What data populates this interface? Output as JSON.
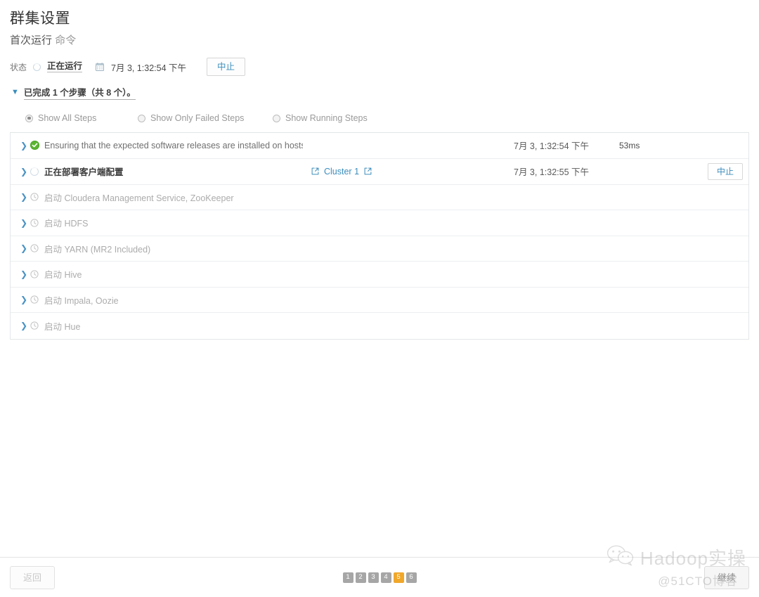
{
  "header": {
    "title": "群集设置",
    "subtitle_strong": "首次运行",
    "subtitle_light": "命令"
  },
  "status": {
    "label": "状态",
    "state_text": "正在运行",
    "spinner_icon": "spinner-icon",
    "calendar_icon": "calendar-icon",
    "time": "7月 3, 1:32:54 下午",
    "abort_label": "中止"
  },
  "progress": {
    "chevron_icon": "chevron-down-icon",
    "summary": "已完成 1 个步骤（共 8 个）。"
  },
  "filters": [
    {
      "label": "Show All Steps",
      "selected": true
    },
    {
      "label": "Show Only Failed Steps",
      "selected": false
    },
    {
      "label": "Show Running Steps",
      "selected": false
    }
  ],
  "steps": [
    {
      "name": "Ensuring that the expected software releases are installed on hosts.",
      "state": "done",
      "status_icon": "check-circle-icon",
      "context": "",
      "context_link_icon": "",
      "time": "7月 3, 1:32:54 下午",
      "duration": "53ms",
      "action": ""
    },
    {
      "name": "正在部署客户端配置",
      "state": "running",
      "status_icon": "spinner-icon",
      "context": "Cluster 1",
      "context_link_icon": "external-link-icon",
      "time": "7月 3, 1:32:55 下午",
      "duration": "",
      "action": "中止"
    },
    {
      "name": "启动 Cloudera Management Service, ZooKeeper",
      "state": "pending",
      "status_icon": "clock-icon",
      "context": "",
      "context_link_icon": "",
      "time": "",
      "duration": "",
      "action": ""
    },
    {
      "name": "启动 HDFS",
      "state": "pending",
      "status_icon": "clock-icon",
      "context": "",
      "context_link_icon": "",
      "time": "",
      "duration": "",
      "action": ""
    },
    {
      "name": "启动 YARN (MR2 Included)",
      "state": "pending",
      "status_icon": "clock-icon",
      "context": "",
      "context_link_icon": "",
      "time": "",
      "duration": "",
      "action": ""
    },
    {
      "name": "启动 Hive",
      "state": "pending",
      "status_icon": "clock-icon",
      "context": "",
      "context_link_icon": "",
      "time": "",
      "duration": "",
      "action": ""
    },
    {
      "name": "启动 Impala, Oozie",
      "state": "pending",
      "status_icon": "clock-icon",
      "context": "",
      "context_link_icon": "",
      "time": "",
      "duration": "",
      "action": ""
    },
    {
      "name": "启动 Hue",
      "state": "pending",
      "status_icon": "clock-icon",
      "context": "",
      "context_link_icon": "",
      "time": "",
      "duration": "",
      "action": ""
    }
  ],
  "footer": {
    "back_label": "返回",
    "continue_label": "继续",
    "pages": [
      "1",
      "2",
      "3",
      "4",
      "5",
      "6"
    ],
    "current_page": "5"
  },
  "watermark": {
    "logo_icon": "wechat-icon",
    "brand": "Hadoop实操",
    "attribution": "@51CTO博客"
  },
  "colors": {
    "link": "#3c8dbc",
    "success": "#5cb531",
    "pager_active": "#f0a72a",
    "pager": "#a6a6a6",
    "border": "#e3e6e8"
  }
}
